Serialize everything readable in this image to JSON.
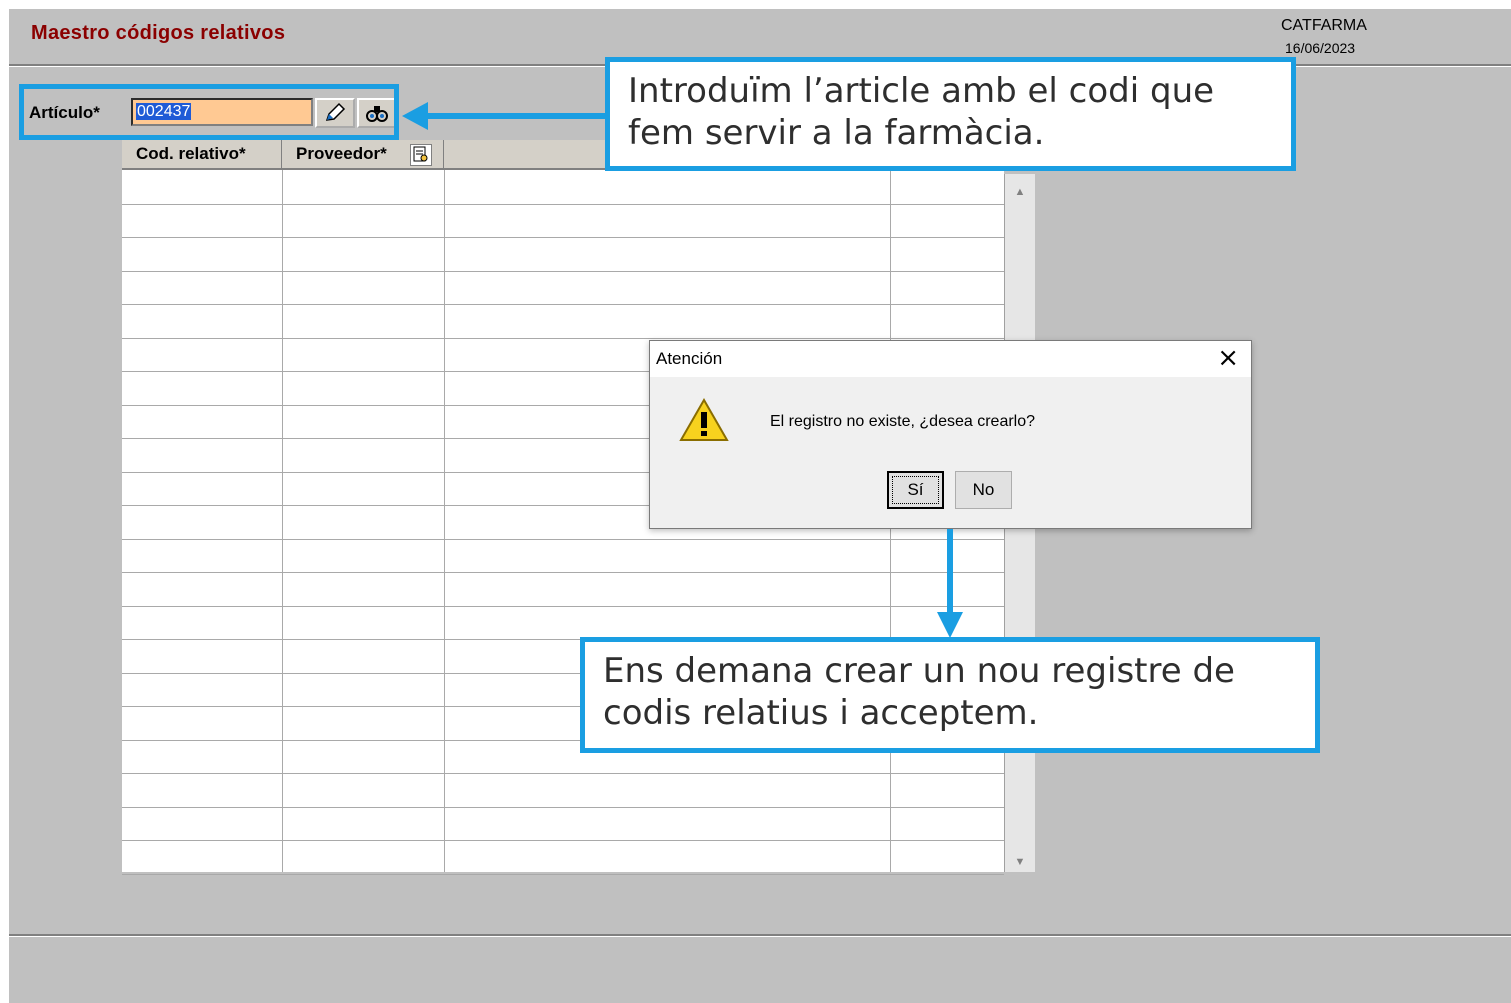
{
  "app": {
    "title": "Maestro códigos relativos",
    "brand": "CATFARMA",
    "date": "16/06/2023"
  },
  "article": {
    "label": "Artículo*",
    "value": "002437"
  },
  "grid": {
    "columns": [
      {
        "label": "Cod. relativo*"
      },
      {
        "label": "Proveedor*"
      },
      {
        "label": ""
      },
      {
        "label": ""
      }
    ],
    "row_count": 21
  },
  "callouts": {
    "top": "Introduïm l’article amb el codi que fem servir a la farmàcia.",
    "bottom": "Ens demana crear un nou registre de codis relatius i acceptem."
  },
  "dialog": {
    "title": "Atención",
    "message": "El registro no existe, ¿desea crearlo?",
    "yes_label": "Sí",
    "no_label": "No",
    "icon": "warning-icon"
  },
  "colors": {
    "accent": "#1a9ee2",
    "title": "#8b0000",
    "input_bg": "#ffc993"
  }
}
